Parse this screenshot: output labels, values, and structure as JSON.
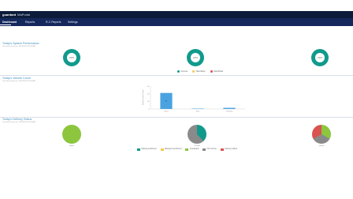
{
  "header": {
    "brand": "guardant",
    "brand_sub": "MaPortal"
  },
  "nav": {
    "items": [
      {
        "label": "Dashboard",
        "active": true
      },
      {
        "label": "Reports",
        "active": false
      },
      {
        "label": "R-C Reports",
        "active": false
      },
      {
        "label": "Settings",
        "active": false
      }
    ]
  },
  "colors": {
    "teal": "#119a8c",
    "yellow": "#f2c94c",
    "red": "#d9534f",
    "blue": "#4aa3e0",
    "green": "#8cc63f",
    "gray": "#8a8a8a",
    "orange": "#f08c35"
  },
  "section_performance": {
    "title": "Today's System Performance",
    "subtitle": "Last data refresh on: 2023-06-15 06:04 AM",
    "donuts": [
      {
        "label": "100%"
      },
      {
        "label": "100%"
      },
      {
        "label": "100%"
      }
    ],
    "legend": [
      {
        "label": "Success",
        "color": "#119a8c"
      },
      {
        "label": "Warn/Delay",
        "color": "#f2c94c"
      },
      {
        "label": "Failed/Fatal",
        "color": "#d9534f"
      }
    ]
  },
  "section_volume": {
    "title": "Today's Volume Count",
    "subtitle": "Last data refresh on: 2023-06-15 06:04 AM"
  },
  "chart_data": {
    "type": "bar",
    "categories": [
      "Inbox",
      "Sent",
      "Pending"
    ],
    "values": [
      42,
      1,
      3
    ],
    "data_labels": [
      "42",
      "",
      ""
    ],
    "ylabel": "Files/records Count",
    "ylim": [
      0,
      60
    ],
    "yticks": [
      "60",
      "40",
      "20",
      "0"
    ],
    "grid": false,
    "color": "#4aa3e0"
  },
  "section_status": {
    "title": "Today's Delivery Status",
    "subtitle": "Last data refresh on: 2023-06-15 06:04 AM",
    "pies": [
      {
        "label": "Batch",
        "color": "#8cc63f"
      },
      {
        "label": "Current",
        "color": "#119a8c"
      },
      {
        "label": "Queue",
        "color": "#8a8a8a"
      }
    ],
    "legend": [
      {
        "label": "Missing Confirmed",
        "color": "#119a8c"
      },
      {
        "label": "Missing Unconfirmed",
        "color": "#f2c94c"
      },
      {
        "label": "Completed",
        "color": "#8cc63f"
      },
      {
        "label": "Not Yet Due",
        "color": "#8a8a8a"
      },
      {
        "label": "Delivery Failure",
        "color": "#d9534f"
      }
    ]
  }
}
